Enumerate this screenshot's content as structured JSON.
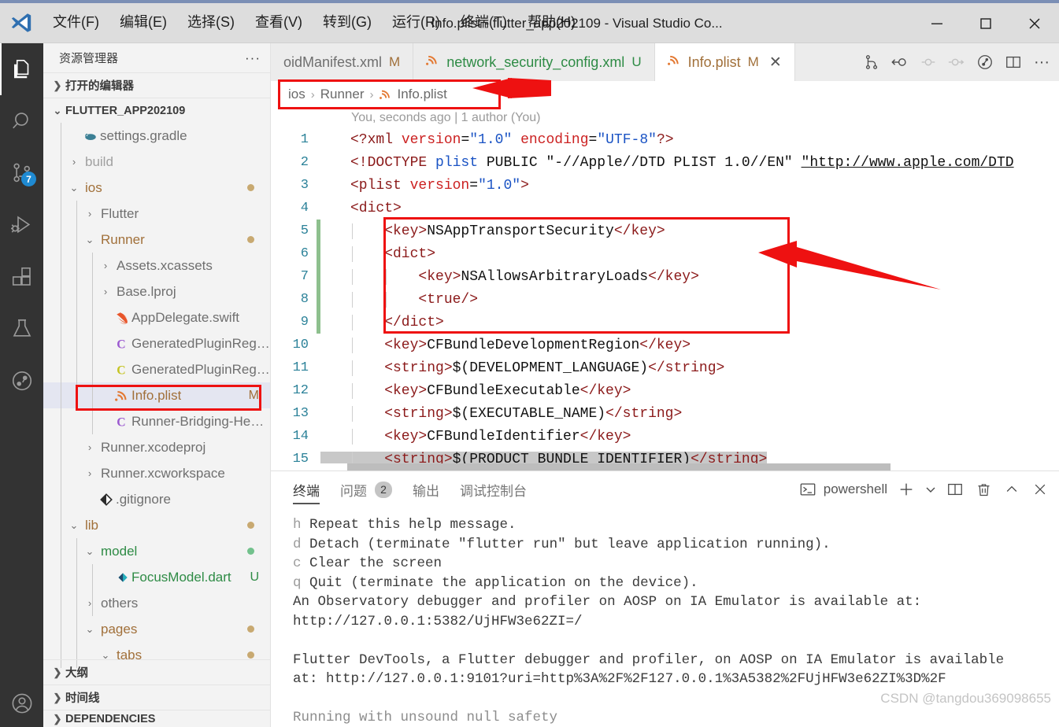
{
  "titlebar": {
    "logo_icon": "vscode-logo-icon",
    "menus": [
      {
        "label": "文件(F)"
      },
      {
        "label": "编辑(E)"
      },
      {
        "label": "选择(S)"
      },
      {
        "label": "查看(V)"
      },
      {
        "label": "转到(G)"
      },
      {
        "label": "运行(R)"
      },
      {
        "label": "终端(T)"
      },
      {
        "label": "帮助(H)"
      }
    ],
    "window_title": "Info.plist - flutter_app202109 - Visual Studio Co...",
    "minimize": "—",
    "maximize": "☐",
    "close": "✕"
  },
  "activitybar": {
    "items": [
      {
        "name": "explorer",
        "icon": "files-icon",
        "active": true,
        "badge": ""
      },
      {
        "name": "search",
        "icon": "search-icon",
        "active": false,
        "badge": ""
      },
      {
        "name": "source-control",
        "icon": "source-control-icon",
        "active": false,
        "badge": "7"
      },
      {
        "name": "run-and-debug",
        "icon": "run-debug-icon",
        "active": false,
        "badge": ""
      },
      {
        "name": "extensions",
        "icon": "extensions-icon",
        "active": false,
        "badge": ""
      },
      {
        "name": "testing",
        "icon": "beaker-icon",
        "active": false,
        "badge": ""
      },
      {
        "name": "dart-devtools",
        "icon": "dart-devtools-icon",
        "active": false,
        "badge": ""
      }
    ],
    "account_icon": "account-icon"
  },
  "sidebar": {
    "title": "资源管理器",
    "more_actions": "···",
    "sections": [
      {
        "label": "打开的编辑器",
        "expanded": false
      },
      {
        "label": "FLUTTER_APP202109",
        "expanded": true
      }
    ],
    "tree": [
      {
        "label": "settings.gradle",
        "icon": "gradle-icon",
        "indent": 1,
        "type": "file",
        "twisty": "",
        "suffix": "",
        "state": "normal",
        "dot": ""
      },
      {
        "label": "build",
        "icon": "",
        "indent": 1,
        "type": "folder",
        "twisty": "›",
        "suffix": "",
        "state": "ignored",
        "dot": ""
      },
      {
        "label": "ios",
        "icon": "",
        "indent": 1,
        "type": "folder",
        "twisty": "⌄",
        "suffix": "",
        "state": "modified",
        "dot": "#c8a971"
      },
      {
        "label": "Flutter",
        "icon": "",
        "indent": 2,
        "type": "folder",
        "twisty": "›",
        "suffix": "",
        "state": "normal",
        "dot": ""
      },
      {
        "label": "Runner",
        "icon": "",
        "indent": 2,
        "type": "folder",
        "twisty": "⌄",
        "suffix": "",
        "state": "modified",
        "dot": "#c8a971"
      },
      {
        "label": "Assets.xcassets",
        "icon": "",
        "indent": 3,
        "type": "folder",
        "twisty": "›",
        "suffix": "",
        "state": "normal",
        "dot": ""
      },
      {
        "label": "Base.lproj",
        "icon": "",
        "indent": 3,
        "type": "folder",
        "twisty": "›",
        "suffix": "",
        "state": "normal",
        "dot": ""
      },
      {
        "label": "AppDelegate.swift",
        "icon": "swift-icon",
        "indent": 3,
        "type": "file",
        "twisty": "",
        "suffix": "",
        "state": "normal",
        "dot": ""
      },
      {
        "label": "GeneratedPluginRegis...",
        "icon": "c-purple-icon",
        "indent": 3,
        "type": "file",
        "twisty": "",
        "suffix": "",
        "state": "normal",
        "dot": ""
      },
      {
        "label": "GeneratedPluginRegis...",
        "icon": "c-yellow-icon",
        "indent": 3,
        "type": "file",
        "twisty": "",
        "suffix": "",
        "state": "normal",
        "dot": ""
      },
      {
        "label": "Info.plist",
        "icon": "xml-icon",
        "indent": 3,
        "type": "file",
        "twisty": "",
        "suffix": "M",
        "state": "modified",
        "dot": "",
        "selected": true
      },
      {
        "label": "Runner-Bridging-Head...",
        "icon": "c-purple-icon",
        "indent": 3,
        "type": "file",
        "twisty": "",
        "suffix": "",
        "state": "normal",
        "dot": ""
      },
      {
        "label": "Runner.xcodeproj",
        "icon": "",
        "indent": 2,
        "type": "folder",
        "twisty": "›",
        "suffix": "",
        "state": "normal",
        "dot": ""
      },
      {
        "label": "Runner.xcworkspace",
        "icon": "",
        "indent": 2,
        "type": "folder",
        "twisty": "›",
        "suffix": "",
        "state": "normal",
        "dot": ""
      },
      {
        "label": ".gitignore",
        "icon": "git-icon",
        "indent": 2,
        "type": "file",
        "twisty": "",
        "suffix": "",
        "state": "normal",
        "dot": ""
      },
      {
        "label": "lib",
        "icon": "",
        "indent": 1,
        "type": "folder",
        "twisty": "⌄",
        "suffix": "",
        "state": "modified",
        "dot": "#c8a971"
      },
      {
        "label": "model",
        "icon": "",
        "indent": 2,
        "type": "folder",
        "twisty": "⌄",
        "suffix": "",
        "state": "untracked",
        "dot": "#72c18c"
      },
      {
        "label": "FocusModel.dart",
        "icon": "dart-icon",
        "indent": 3,
        "type": "file",
        "twisty": "",
        "suffix": "U",
        "state": "untracked",
        "dot": ""
      },
      {
        "label": "others",
        "icon": "",
        "indent": 2,
        "type": "folder",
        "twisty": "›",
        "suffix": "",
        "state": "normal",
        "dot": ""
      },
      {
        "label": "pages",
        "icon": "",
        "indent": 2,
        "type": "folder",
        "twisty": "⌄",
        "suffix": "",
        "state": "modified",
        "dot": "#c8a971"
      },
      {
        "label": "tabs",
        "icon": "",
        "indent": 3,
        "type": "folder",
        "twisty": "⌄",
        "suffix": "",
        "state": "modified",
        "dot": "#c8a971"
      }
    ],
    "bottom_sections": [
      {
        "label": "大纲"
      },
      {
        "label": "时间线"
      },
      {
        "label": "DEPENDENCIES"
      }
    ]
  },
  "editor": {
    "tabs": [
      {
        "label": "oidManifest.xml",
        "flag": "M",
        "flag_type": "mod",
        "icon": "",
        "active": false,
        "closable": false
      },
      {
        "label": "network_security_config.xml",
        "flag": "U",
        "flag_type": "untracked",
        "icon": "xml-icon",
        "active": false,
        "closable": false
      },
      {
        "label": "Info.plist",
        "flag": "M",
        "flag_type": "mod",
        "icon": "xml-icon",
        "active": true,
        "closable": true,
        "close_label": "✕"
      }
    ],
    "tab_actions": [
      {
        "name": "split-in-group-icon"
      },
      {
        "name": "go-back-icon"
      },
      {
        "name": "previous-change-icon"
      },
      {
        "name": "next-change-icon"
      },
      {
        "name": "dart-run-icon"
      },
      {
        "name": "split-editor-icon"
      },
      {
        "name": "more-actions-icon",
        "label": "···"
      }
    ],
    "breadcrumb": [
      "ios",
      "Runner",
      "Info.plist"
    ],
    "breadcrumb_separator": "›",
    "breadcrumb_file_icon": "xml-icon",
    "blame": "You, seconds ago | 1 author (You)",
    "lines": [
      {
        "num": "1",
        "changed": false,
        "indent_guides": 0,
        "tokens": [
          {
            "t": "<?xml ",
            "c": "tag"
          },
          {
            "t": "version",
            "c": "attr"
          },
          {
            "t": "=",
            "c": "plain"
          },
          {
            "t": "\"1.0\"",
            "c": "val"
          },
          {
            "t": " ",
            "c": "plain"
          },
          {
            "t": "encoding",
            "c": "attr"
          },
          {
            "t": "=",
            "c": "plain"
          },
          {
            "t": "\"UTF-8\"",
            "c": "val"
          },
          {
            "t": "?>",
            "c": "tag"
          }
        ]
      },
      {
        "num": "2",
        "changed": false,
        "indent_guides": 0,
        "tokens": [
          {
            "t": "<!DOCTYPE ",
            "c": "tag"
          },
          {
            "t": "plist",
            "c": "blue"
          },
          {
            "t": " PUBLIC ",
            "c": "plain"
          },
          {
            "t": "\"-//Apple//DTD PLIST 1.0//EN\"",
            "c": "plain"
          },
          {
            "t": " ",
            "c": "plain"
          },
          {
            "t": "\"http://www.apple.com/DTD",
            "c": "link"
          }
        ]
      },
      {
        "num": "3",
        "changed": false,
        "indent_guides": 0,
        "tokens": [
          {
            "t": "<plist ",
            "c": "tag"
          },
          {
            "t": "version",
            "c": "attr"
          },
          {
            "t": "=",
            "c": "plain"
          },
          {
            "t": "\"1.0\"",
            "c": "val"
          },
          {
            "t": ">",
            "c": "tag"
          }
        ]
      },
      {
        "num": "4",
        "changed": false,
        "indent_guides": 0,
        "tokens": [
          {
            "t": "<dict>",
            "c": "tag"
          }
        ]
      },
      {
        "num": "5",
        "changed": true,
        "indent_guides": 1,
        "tokens": [
          {
            "t": "    <key>",
            "c": "tag"
          },
          {
            "t": "NSAppTransportSecurity",
            "c": "plain"
          },
          {
            "t": "</key>",
            "c": "tag"
          }
        ]
      },
      {
        "num": "6",
        "changed": true,
        "indent_guides": 1,
        "tokens": [
          {
            "t": "    <dict>",
            "c": "tag"
          }
        ]
      },
      {
        "num": "7",
        "changed": true,
        "indent_guides": 2,
        "tokens": [
          {
            "t": "        <key>",
            "c": "tag"
          },
          {
            "t": "NSAllowsArbitraryLoads",
            "c": "plain"
          },
          {
            "t": "</key>",
            "c": "tag"
          }
        ]
      },
      {
        "num": "8",
        "changed": true,
        "indent_guides": 2,
        "tokens": [
          {
            "t": "        <true/>",
            "c": "tag"
          }
        ]
      },
      {
        "num": "9",
        "changed": true,
        "indent_guides": 1,
        "tokens": [
          {
            "t": "    </dict>",
            "c": "tag"
          }
        ]
      },
      {
        "num": "10",
        "changed": false,
        "indent_guides": 1,
        "tokens": [
          {
            "t": "    <key>",
            "c": "tag"
          },
          {
            "t": "CFBundleDevelopmentRegion",
            "c": "plain"
          },
          {
            "t": "</key>",
            "c": "tag"
          }
        ]
      },
      {
        "num": "11",
        "changed": false,
        "indent_guides": 1,
        "tokens": [
          {
            "t": "    <string>",
            "c": "tag"
          },
          {
            "t": "$(DEVELOPMENT_LANGUAGE)",
            "c": "plain"
          },
          {
            "t": "</string>",
            "c": "tag"
          }
        ]
      },
      {
        "num": "12",
        "changed": false,
        "indent_guides": 1,
        "tokens": [
          {
            "t": "    <key>",
            "c": "tag"
          },
          {
            "t": "CFBundleExecutable",
            "c": "plain"
          },
          {
            "t": "</key>",
            "c": "tag"
          }
        ]
      },
      {
        "num": "13",
        "changed": false,
        "indent_guides": 1,
        "tokens": [
          {
            "t": "    <string>",
            "c": "tag"
          },
          {
            "t": "$(EXECUTABLE_NAME)",
            "c": "plain"
          },
          {
            "t": "</string>",
            "c": "tag"
          }
        ]
      },
      {
        "num": "14",
        "changed": false,
        "indent_guides": 1,
        "tokens": [
          {
            "t": "    <key>",
            "c": "tag"
          },
          {
            "t": "CFBundleIdentifier",
            "c": "plain"
          },
          {
            "t": "</key>",
            "c": "tag"
          }
        ]
      },
      {
        "num": "15",
        "changed": false,
        "indent_guides": 1,
        "highlight": true,
        "tokens": [
          {
            "t": "    <string>",
            "c": "tag"
          },
          {
            "t": "$(PRODUCT_BUNDLE_IDENTIFIER)",
            "c": "plain"
          },
          {
            "t": "</string>",
            "c": "tag"
          }
        ]
      }
    ]
  },
  "panel": {
    "tabs": [
      {
        "label": "终端",
        "badge": "",
        "active": true
      },
      {
        "label": "问题",
        "badge": "2",
        "active": false
      },
      {
        "label": "输出",
        "badge": "",
        "active": false
      },
      {
        "label": "调试控制台",
        "badge": "",
        "active": false
      }
    ],
    "shell_icon": "terminal-icon",
    "shell_name": "powershell",
    "actions": [
      {
        "name": "new-terminal-icon",
        "glyph": "+"
      },
      {
        "name": "terminal-dropdown-icon",
        "glyph": "⌄"
      },
      {
        "name": "split-terminal-icon",
        "glyph": "▯▯"
      },
      {
        "name": "kill-terminal-icon",
        "glyph": "🗑"
      },
      {
        "name": "maximize-panel-icon",
        "glyph": "︿"
      },
      {
        "name": "close-panel-icon",
        "glyph": "✕"
      }
    ],
    "terminal_lines": [
      {
        "key": "h",
        "text": " Repeat this help message."
      },
      {
        "key": "d",
        "text": " Detach (terminate \"flutter run\" but leave application running)."
      },
      {
        "key": "c",
        "text": " Clear the screen"
      },
      {
        "key": "q",
        "text": " Quit (terminate the application on the device)."
      },
      {
        "key": "",
        "text": "An Observatory debugger and profiler on AOSP on IA Emulator is available at:"
      },
      {
        "key": "",
        "text": "http://127.0.0.1:5382/UjHFW3e62ZI=/"
      },
      {
        "key": "",
        "text": ""
      },
      {
        "key": "",
        "text": "Flutter DevTools, a Flutter debugger and profiler, on AOSP on IA Emulator is available"
      },
      {
        "key": "",
        "text": "at: http://127.0.0.1:9101?uri=http%3A%2F%2F127.0.0.1%3A5382%2FUjHFW3e62ZI%3D%2F"
      },
      {
        "key": "",
        "text": ""
      },
      {
        "key": "",
        "text": "Running with unsound null safety",
        "gray": true
      }
    ],
    "watermark": "CSDN @tangdou369098655"
  },
  "annotations": {
    "accent_color": "#ee1111",
    "boxes": [
      {
        "name": "breadcrumb-highlight-box"
      },
      {
        "name": "code-block-highlight-box"
      },
      {
        "name": "info-plist-sidebar-highlight-box"
      }
    ],
    "arrows": [
      {
        "name": "breadcrumb-arrow"
      },
      {
        "name": "code-block-arrow"
      }
    ]
  }
}
